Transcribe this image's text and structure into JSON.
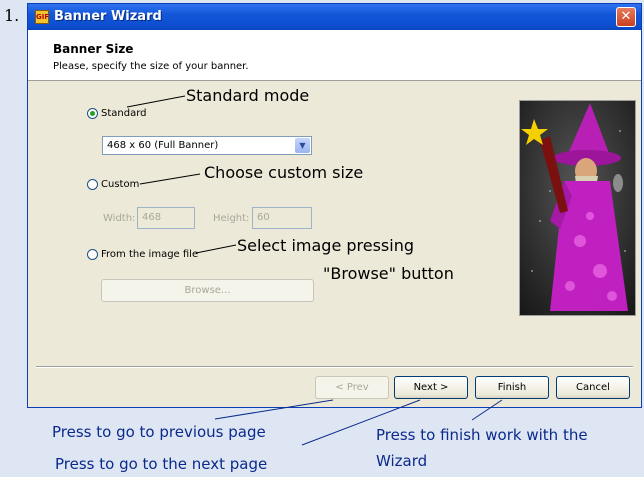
{
  "step_number": "1.",
  "window": {
    "title": "Banner Wizard",
    "icon_text": "GIF"
  },
  "header": {
    "title": "Banner Size",
    "subtitle": "Please, specify the size of your banner."
  },
  "options": {
    "standard_label": "Standard",
    "standard_selected": true,
    "size_select_value": "468 x 60 (Full Banner)",
    "custom_label": "Custom",
    "width_label": "Width:",
    "width_value": "468",
    "height_label": "Height:",
    "height_value": "60",
    "from_file_label": "From the image file",
    "browse_label": "Browse..."
  },
  "buttons": {
    "prev": "< Prev",
    "next": "Next >",
    "finish": "Finish",
    "cancel": "Cancel"
  },
  "annotations": {
    "standard": "Standard mode",
    "custom": "Choose custom size",
    "file_line1": "Select image pressing",
    "file_line2": "\"Browse\" button",
    "prev": "Press to go to previous page",
    "next": "Press to go to the next page",
    "finish_line1": "Press to finish work with the",
    "finish_line2": "Wizard"
  },
  "colors": {
    "titlebar": "#0c4fd0",
    "annotation_blue": "#0a2a8c",
    "radio_dot": "#21a121",
    "wizard_robe": "#c020c0"
  },
  "icons": [
    "close-icon",
    "dropdown-arrow-icon",
    "wizard-illustration"
  ]
}
